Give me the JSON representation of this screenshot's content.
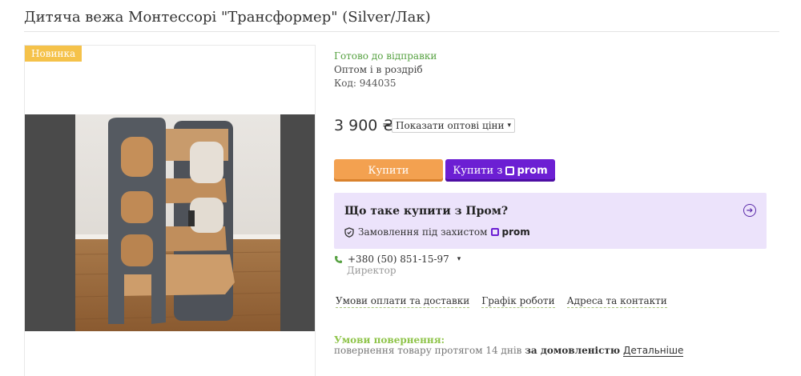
{
  "product": {
    "title": "Дитяча вежа Монтессорі \"Трансформер\" (Silver/Лак)",
    "badge": "Новинка",
    "status": "Готово до відправки",
    "wholesale_note": "Оптом і в роздріб",
    "code": "Код: 944035",
    "price": "3 900 ₴",
    "price_select": "Показати оптові ціни"
  },
  "actions": {
    "buy_label": "Купити",
    "buy_with_label": "Купити з",
    "prom_logo_text": "prom"
  },
  "info": {
    "title": "Що таке купити з Пром?",
    "protected_label": "Замовлення під захистом",
    "prom_logo_text": "prom"
  },
  "contact": {
    "phone": "+380 (50) 851-15-97",
    "role": "Директор"
  },
  "links": [
    "Умови оплати та доставки",
    "Графік роботи",
    "Адреса та контакти"
  ],
  "returns": {
    "title": "Умови повернення:",
    "text": "повернення товару протягом 14 днів",
    "agreement": "за домовленістю",
    "more": "Детальніше"
  },
  "colors": {
    "accent_green": "#56a141",
    "buy_orange": "#f3a150",
    "prom_purple": "#6c1fd3",
    "info_bg": "#ece3fb",
    "badge_yellow": "#f5c24a"
  },
  "icons": [
    "arrow-right-circle-icon",
    "shield-icon",
    "phone-icon",
    "chevron-down-icon"
  ]
}
